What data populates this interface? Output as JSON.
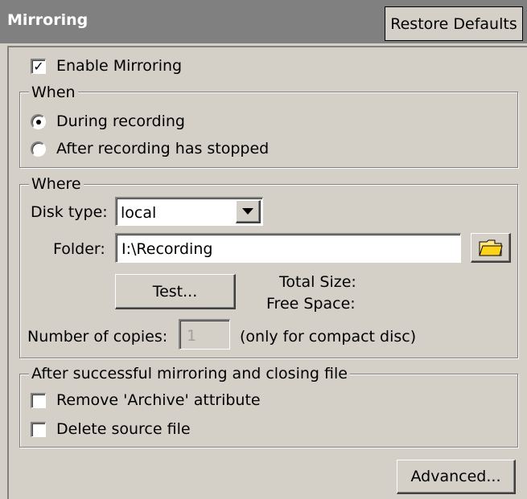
{
  "header": {
    "title": "Mirroring",
    "restore_defaults": "Restore Defaults"
  },
  "enable_mirroring": {
    "label": "Enable Mirroring",
    "checked": true
  },
  "when": {
    "legend": "When",
    "options": [
      {
        "label": "During recording",
        "selected": true
      },
      {
        "label": "After recording has stopped",
        "selected": false
      }
    ]
  },
  "where": {
    "legend": "Where",
    "disk_type_label": "Disk type:",
    "disk_type_value": "local",
    "folder_label": "Folder:",
    "folder_value": "I:\\Recording",
    "test_button": "Test...",
    "total_size_label": "Total Size:",
    "free_space_label": "Free Space:",
    "copies_label": "Number of copies:",
    "copies_value": "1",
    "copies_note": "(only for compact disc)"
  },
  "after": {
    "legend": "After successful mirroring and closing file",
    "options": [
      {
        "label": "Remove 'Archive' attribute",
        "checked": false
      },
      {
        "label": "Delete source file",
        "checked": false
      }
    ]
  },
  "advanced_button": "Advanced...",
  "icons": {
    "folder": "folder-browse-icon",
    "dropdown": "chevron-down-icon"
  }
}
